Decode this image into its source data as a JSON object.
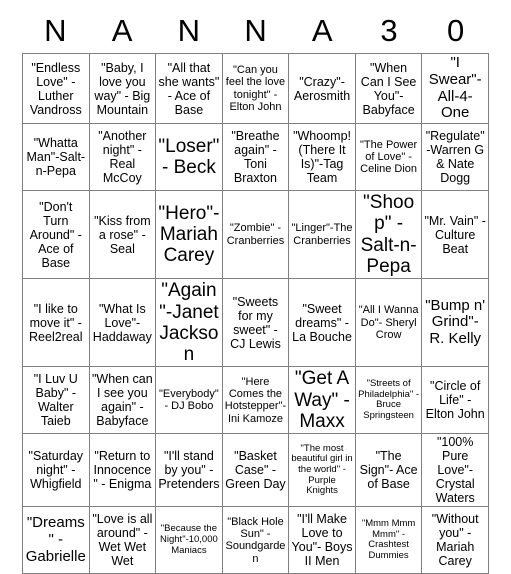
{
  "card": {
    "title_letters": [
      "N",
      "A",
      "N",
      "N",
      "A",
      "3",
      "0"
    ],
    "columns": 7,
    "rows": 7,
    "border_color": "#808080",
    "text_color": "#000000",
    "background_color": "#ffffff",
    "cells": [
      [
        {
          "text": "\"Endless Love\" - Luther Vandross",
          "size": "m"
        },
        {
          "text": "\"Baby, I love you way\" - Big Mountain",
          "size": "m"
        },
        {
          "text": "\"All that she wants\" - Ace of Base",
          "size": "m"
        },
        {
          "text": "\"Can you feel the love tonight\" - Elton John",
          "size": "s"
        },
        {
          "text": "\"Crazy\"-Aerosmith",
          "size": "m"
        },
        {
          "text": "\"When Can I See You\"-Babyface",
          "size": "m"
        },
        {
          "text": "\"I Swear\"-All-4-One",
          "size": "l"
        }
      ],
      [
        {
          "text": "\"Whatta Man\"-Salt-n-Pepa",
          "size": "m"
        },
        {
          "text": "\"Another night\" - Real McCoy",
          "size": "m"
        },
        {
          "text": "\"Loser\" - Beck",
          "size": "xl"
        },
        {
          "text": "\"Breathe again\" - Toni Braxton",
          "size": "m"
        },
        {
          "text": "\"Whoomp! (There It Is)\"-Tag Team",
          "size": "m"
        },
        {
          "text": "\"The Power of Love\" - Celine Dion",
          "size": "s"
        },
        {
          "text": "\"Regulate\"-Warren G & Nate Dogg",
          "size": "m"
        }
      ],
      [
        {
          "text": "\"Don't Turn Around\" - Ace of Base",
          "size": "m"
        },
        {
          "text": "\"Kiss from a rose\" - Seal",
          "size": "m"
        },
        {
          "text": "\"Hero\"-Mariah Carey",
          "size": "xl"
        },
        {
          "text": "\"Zombie\" - Cranberries",
          "size": "s"
        },
        {
          "text": "\"Linger\"-The Cranberries",
          "size": "s"
        },
        {
          "text": "\"Shoop\" - Salt-n-Pepa",
          "size": "xl"
        },
        {
          "text": "\"Mr. Vain\" - Culture Beat",
          "size": "m"
        }
      ],
      [
        {
          "text": "\"I like to move it\" - Reel2real",
          "size": "m"
        },
        {
          "text": "\"What Is Love\"-Haddaway",
          "size": "m"
        },
        {
          "text": "\"Again\"-Janet Jackson",
          "size": "xl"
        },
        {
          "text": "\"Sweets for my sweet\" - CJ Lewis",
          "size": "m"
        },
        {
          "text": "\"Sweet dreams\" - La Bouche",
          "size": "m"
        },
        {
          "text": "\"All I Wanna Do\"- Sheryl Crow",
          "size": "s"
        },
        {
          "text": "\"Bump n' Grind\"- R. Kelly",
          "size": "l"
        }
      ],
      [
        {
          "text": "\"I Luv U Baby\" - Walter Taieb",
          "size": "m"
        },
        {
          "text": "\"When can I see you again\" - Babyface",
          "size": "m"
        },
        {
          "text": "\"Everybody\" - DJ Bobo",
          "size": "s"
        },
        {
          "text": "\"Here Comes the Hotstepper\"- Ini Kamoze",
          "size": "s"
        },
        {
          "text": "\"Get A Way\" - Maxx",
          "size": "xl"
        },
        {
          "text": "\"Streets of Philadelphia\" - Bruce Springsteen",
          "size": "xs"
        },
        {
          "text": "\"Circle of Life\" - Elton John",
          "size": "m"
        }
      ],
      [
        {
          "text": "\"Saturday night\" - Whigfield",
          "size": "m"
        },
        {
          "text": "\"Return to Innocence\" - Enigma",
          "size": "m"
        },
        {
          "text": "\"I'll stand by you\" - Pretenders",
          "size": "m"
        },
        {
          "text": "\"Basket Case\" - Green Day",
          "size": "m"
        },
        {
          "text": "\"The most beautiful girl in the world\" - Purple Knights",
          "size": "xs"
        },
        {
          "text": "\"The Sign\"- Ace of Base",
          "size": "m"
        },
        {
          "text": "\"100% Pure Love\"- Crystal Waters",
          "size": "m"
        }
      ],
      [
        {
          "text": "\"Dreams\" - Gabrielle",
          "size": "l"
        },
        {
          "text": "\"Love is all around\" - Wet Wet Wet",
          "size": "m"
        },
        {
          "text": "\"Because the Night\"-10,000 Maniacs",
          "size": "xs"
        },
        {
          "text": "\"Black Hole Sun\" - Soundgarden",
          "size": "s"
        },
        {
          "text": "\"I'll Make Love to You\"- Boys II Men",
          "size": "m"
        },
        {
          "text": "\"Mmm Mmm Mmm\" - Crashtest Dummies",
          "size": "xs"
        },
        {
          "text": "\"Without you\" - Mariah Carey",
          "size": "m"
        }
      ]
    ]
  }
}
